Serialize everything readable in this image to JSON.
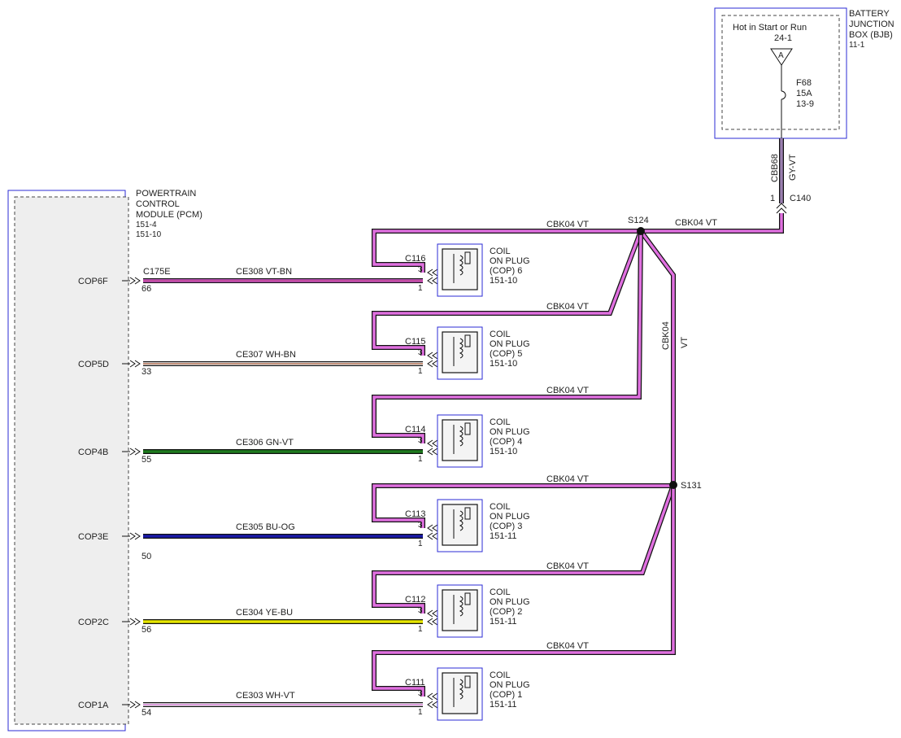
{
  "bjb": {
    "title_lines": [
      "BATTERY",
      "JUNCTION",
      "BOX (BJB)"
    ],
    "ref": "11-1",
    "hot_label": "Hot in Start or Run",
    "hot_ref": "24-1",
    "terminal": "A",
    "fuse_lines": [
      "F68",
      "15A",
      "13-9"
    ]
  },
  "bjb_wire": {
    "circuit": "CBB68",
    "color": "GY-VT",
    "connector": "C140",
    "pin": "1"
  },
  "pcm": {
    "title_lines": [
      "POWERTRAIN",
      "CONTROL",
      "MODULE (PCM)"
    ],
    "refs": [
      "151-4",
      "151-10"
    ],
    "connector": "C175E"
  },
  "splices": [
    "S124",
    "S131"
  ],
  "feed": {
    "main_label": "CBK04   VT",
    "top_label": "CBK04   VT",
    "vertical_circuit": "CBK04",
    "vertical_color": "VT"
  },
  "coils": [
    {
      "pin_name": "COP6F",
      "pcm_pin": "66",
      "circuit": "CE308  VT-BN",
      "connector": "C116",
      "feed_label": "CBK04   VT",
      "pin_a": "3",
      "pin_b": "1",
      "name_lines": [
        "COIL",
        "ON PLUG",
        "(COP) 6",
        "151-10"
      ],
      "wire_color": "#e060e0",
      "wire_stripe": "#b0407a"
    },
    {
      "pin_name": "COP5D",
      "pcm_pin": "33",
      "circuit": "CE307  WH-BN",
      "connector": "C115",
      "feed_label": "CBK04   VT",
      "pin_a": "3",
      "pin_b": "1",
      "name_lines": [
        "COIL",
        "ON PLUG",
        "(COP) 5",
        "151-10"
      ],
      "wire_color": "#ffffff",
      "wire_stripe": "#a0522d"
    },
    {
      "pin_name": "COP4B",
      "pcm_pin": "55",
      "circuit": "CE306  GN-VT",
      "connector": "C114",
      "feed_label": "CBK04   VT",
      "pin_a": "3",
      "pin_b": "1",
      "name_lines": [
        "COIL",
        "ON PLUG",
        "(COP) 4",
        "151-10"
      ],
      "wire_color": "#1f7a1f",
      "wire_stripe": "#1f7a1f"
    },
    {
      "pin_name": "COP3E",
      "pcm_pin": "50",
      "circuit": "CE305  BU-OG",
      "connector": "C113",
      "feed_label": "CBK04   VT",
      "pin_a": "3",
      "pin_b": "1",
      "name_lines": [
        "COIL",
        "ON PLUG",
        "(COP) 3",
        "151-11"
      ],
      "wire_color": "#1a1aa8",
      "wire_stripe": "#1a1aa8"
    },
    {
      "pin_name": "COP2C",
      "pcm_pin": "56",
      "circuit": "CE304  YE-BU",
      "connector": "C112",
      "feed_label": "CBK04   VT",
      "pin_a": "3",
      "pin_b": "1",
      "name_lines": [
        "COIL",
        "ON PLUG",
        "(COP) 2",
        "151-11"
      ],
      "wire_color": "#e6e600",
      "wire_stripe": "#e6e600"
    },
    {
      "pin_name": "COP1A",
      "pcm_pin": "54",
      "circuit": "CE303  WH-VT",
      "connector": "C111",
      "feed_label": "CBK04   VT",
      "pin_a": "3",
      "pin_b": "1",
      "name_lines": [
        "COIL",
        "ON PLUG",
        "(COP) 1",
        "151-11"
      ],
      "wire_color": "#ffffff",
      "wire_stripe": "#cc66cc"
    }
  ],
  "colors": {
    "feed_wire": "#e070e0",
    "box_border": "#2b2bd6",
    "gy_vt": "#9a7fb0"
  }
}
